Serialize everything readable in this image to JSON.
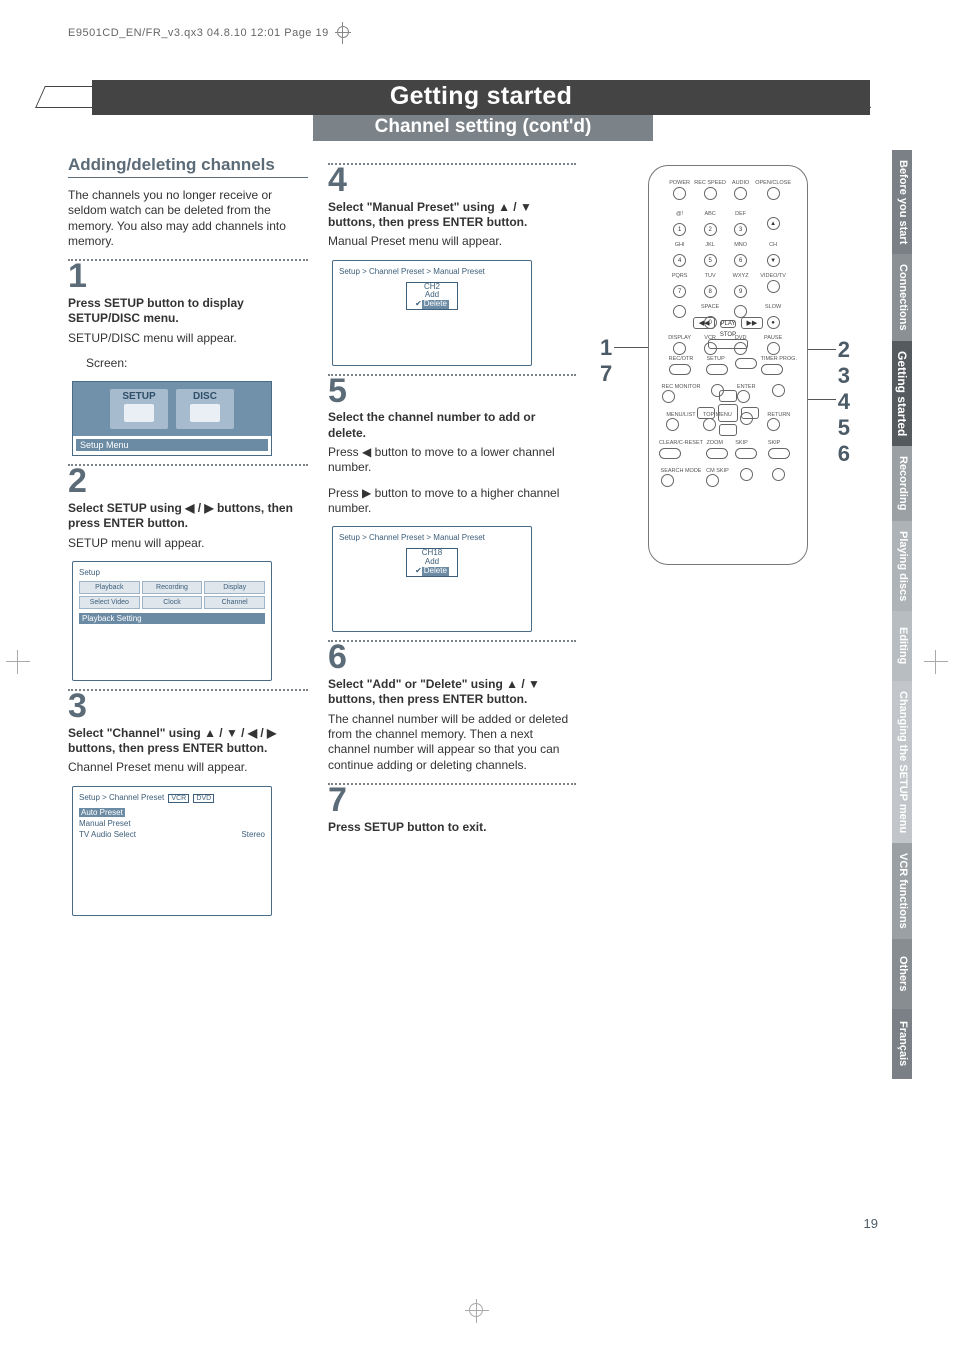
{
  "meta": {
    "line": "E9501CD_EN/FR_v3.qx3  04.8.10  12:01  Page 19"
  },
  "title": "Getting started",
  "subtitle": "Channel setting (cont'd)",
  "section_heading": "Adding/deleting channels",
  "intro": "The channels you no longer receive or seldom watch can be deleted from the memory. You also may add channels into memory.",
  "steps": {
    "s1": {
      "n": "1",
      "bold": "Press SETUP button to display SETUP/DISC menu.",
      "text": "SETUP/DISC menu will appear.",
      "sub": "Screen:"
    },
    "s2": {
      "n": "2",
      "bold": "Select SETUP using ◀ / ▶ buttons, then press ENTER button.",
      "text": "SETUP menu will appear."
    },
    "s3": {
      "n": "3",
      "bold": "Select \"Channel\" using ▲ / ▼ / ◀ / ▶ buttons, then press ENTER button.",
      "text": "Channel Preset menu will appear."
    },
    "s4": {
      "n": "4",
      "bold": "Select \"Manual Preset\" using ▲ / ▼ buttons, then press ENTER button.",
      "text": "Manual Preset menu will appear."
    },
    "s5": {
      "n": "5",
      "bold": "Select the channel number to add or delete.",
      "text1": "Press ◀ button to move to a lower channel number.",
      "text2": "Press ▶ button to move to a higher channel number."
    },
    "s6": {
      "n": "6",
      "bold": "Select \"Add\" or \"Delete\" using ▲ / ▼ buttons, then press ENTER button.",
      "text": "The channel number will be added or deleted from the channel memory. Then a next channel number will appear so that you can continue adding or deleting channels."
    },
    "s7": {
      "n": "7",
      "bold": "Press SETUP button to exit."
    }
  },
  "osd": {
    "screen1": {
      "tab1": "SETUP",
      "tab2": "DISC",
      "caption": "Setup Menu"
    },
    "setup": {
      "title": "Setup",
      "cells": [
        "Playback",
        "Recording",
        "Display",
        "Select Video",
        "Clock",
        "Channel"
      ],
      "caption": "Playback Setting"
    },
    "chpreset": {
      "title": "Setup > Channel Preset",
      "tags": [
        "VCR",
        "DVD"
      ],
      "rows": [
        {
          "l": "Auto Preset",
          "r": ""
        },
        {
          "l": "Manual Preset",
          "r": ""
        },
        {
          "l": "TV Audio Select",
          "r": "Stereo"
        }
      ]
    },
    "manual1": {
      "title": "Setup > Channel Preset > Manual Preset",
      "ch": "CH2",
      "add": "Add",
      "del": "Delete"
    },
    "manual2": {
      "title": "Setup > Channel Preset > Manual Preset",
      "ch": "CH18",
      "add": "Add",
      "del": "Delete"
    }
  },
  "remote_callouts": {
    "left1": "1",
    "left7": "7",
    "right2": "2",
    "right3": "3",
    "right4": "4",
    "right5": "5",
    "right6": "6"
  },
  "remote_labels": {
    "r1": [
      "POWER",
      "REC SPEED",
      "AUDIO",
      "OPEN/CLOSE"
    ],
    "r2": [
      "@!",
      "ABC",
      "DEF",
      ""
    ],
    "r2n": [
      "1",
      "2",
      "3",
      "▲"
    ],
    "r3": [
      "GHI",
      "JKL",
      "MNO",
      "CH"
    ],
    "r3n": [
      "4",
      "5",
      "6",
      "▼"
    ],
    "r4": [
      "PQRS",
      "TUV",
      "WXYZ",
      "VIDEO/TV"
    ],
    "r4n": [
      "7",
      "8",
      "9",
      ""
    ],
    "r5": [
      "",
      "SPACE",
      "",
      "SLOW"
    ],
    "r5n": [
      "",
      "0",
      "",
      "●"
    ],
    "r6": [
      "DISPLAY",
      "VCR",
      "DVD",
      "PAUSE"
    ],
    "play": "PLAY",
    "stop": "STOP",
    "row2a": [
      "REC/OTR",
      "SETUP",
      "",
      "TIMER PROG."
    ],
    "row2b": [
      "REC MONITOR",
      "",
      "ENTER",
      ""
    ],
    "row2c": [
      "MENU/LIST",
      "TOP MENU",
      "",
      "RETURN"
    ],
    "row2d": [
      "CLEAR/C-RESET",
      "ZOOM",
      "SKIP",
      "SKIP"
    ],
    "row2e": [
      "SEARCH MODE",
      "CM SKIP",
      "",
      ""
    ]
  },
  "tabs": [
    "Before you start",
    "Connections",
    "Getting started",
    "Recording",
    "Playing discs",
    "Editing",
    "Changing the SETUP menu",
    "VCR functions",
    "Others",
    "Français"
  ],
  "page_number": "19"
}
